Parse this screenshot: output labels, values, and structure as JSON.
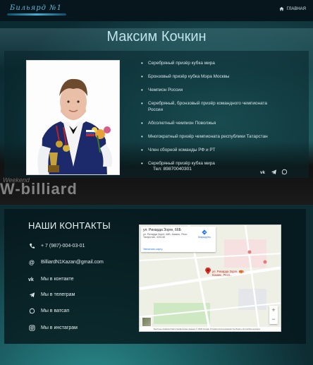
{
  "header": {
    "logo_text": "Бильярд №1",
    "home_label": "ГЛАВНАЯ"
  },
  "background": {
    "banner_text": "W-billiard",
    "banner_small": "Weekend"
  },
  "profile": {
    "name": "Максим Кочкин",
    "achievements": [
      "Серебряный призёр кубка мира",
      "Бронзовый призёр кубка Мэра Москвы",
      "Чемпион России",
      "Серебряный, бронзовый призёр командного чемпионата России",
      "Абсолютный чемпион Поволжья",
      "Многократный призёр чемпионата республики Татарстан",
      "Член сборной команды РФ и РТ",
      "Серебряный призёр кубка мира"
    ],
    "phone": "Тел: 89870040301",
    "socials": [
      "vk-icon",
      "telegram-icon",
      "whatsapp-icon"
    ]
  },
  "contacts": {
    "title": "НАШИ КОНТАКТЫ",
    "items": [
      {
        "icon": "phone-icon",
        "label": "+ 7 (987)-004-03-01"
      },
      {
        "icon": "at-icon",
        "label": "BilliardN1Kazan@gmail.com"
      },
      {
        "icon": "vk-icon",
        "label": "Мы в контакте"
      },
      {
        "icon": "telegram-icon",
        "label": "Мы в телеграм"
      },
      {
        "icon": "whatsapp-icon",
        "label": "Мы в ватсап"
      },
      {
        "icon": "instagram-icon",
        "label": "Мы в инстаграм"
      }
    ]
  },
  "map": {
    "info_title": "ул. Рихарда Зорге, 66Б",
    "info_address": "ул. Рихарда Зорге, 66Б, Казань, Респ. Татарстан, 420138",
    "route_label": "Маршруты",
    "bigger_map_label": "Увеличить карту",
    "pin_label": "ул. Рихарда Зорге, 66Б, Казань, Респ...",
    "zoom_in": "+",
    "zoom_out": "−",
    "footer": "Быстрые клавиши  Картографические данные © 2024 Google  Условия использования  Сообщить об ошибке на карте"
  },
  "colors": {
    "header_bg": "#06161c",
    "accent": "#5fb6d6",
    "title": "#bfe3ea",
    "pin": "#d93025"
  }
}
